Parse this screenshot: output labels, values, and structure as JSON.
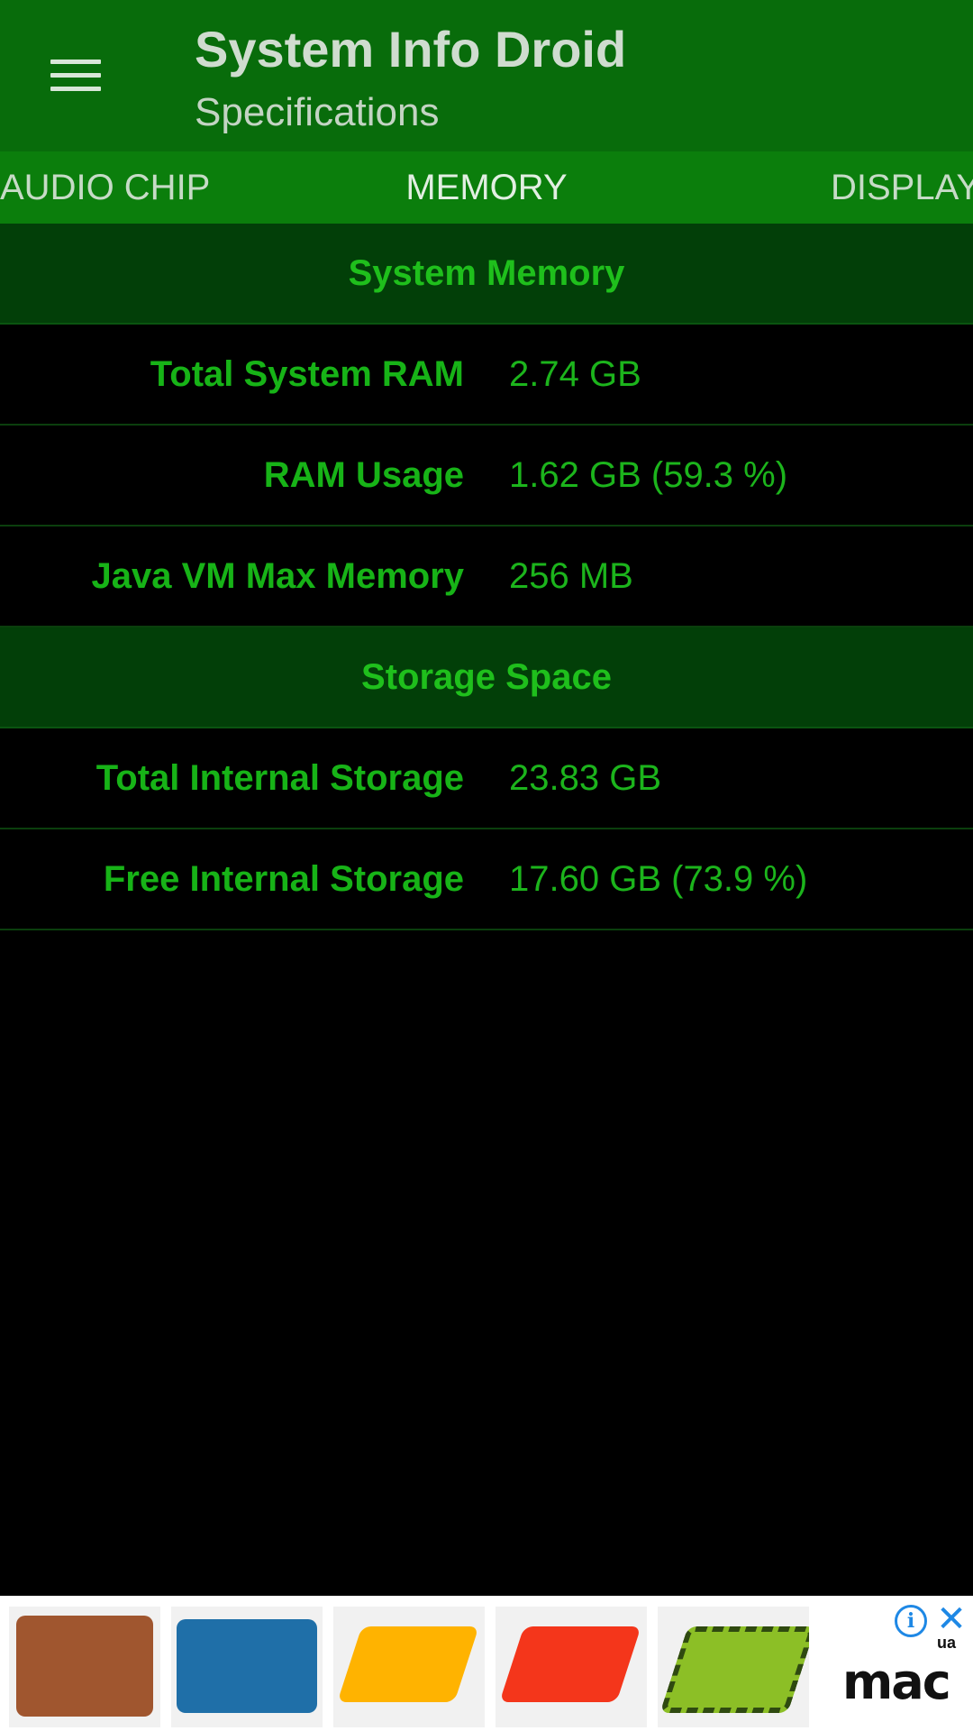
{
  "app_bar": {
    "title": "System Info Droid",
    "subtitle": "Specifications",
    "menu_icon": "hamburger-menu-icon"
  },
  "tabs": [
    {
      "label": "AUDIO CHIP",
      "selected": false
    },
    {
      "label": "MEMORY",
      "selected": true
    },
    {
      "label": "DISPLAY",
      "selected": false
    }
  ],
  "sections": {
    "system_memory": {
      "title": "System Memory",
      "rows": [
        {
          "label": "Total System RAM",
          "value": "2.74 GB"
        },
        {
          "label": "RAM Usage",
          "value": "1.62 GB (59.3 %)"
        },
        {
          "label": "Java VM Max Memory",
          "value": "256 MB"
        }
      ]
    },
    "storage_space": {
      "title": "Storage Space",
      "rows": [
        {
          "label": "Total Internal Storage",
          "value": "23.83 GB"
        },
        {
          "label": "Free Internal Storage",
          "value": "17.60 GB (73.9 %)"
        }
      ]
    }
  },
  "ad": {
    "brand": "mac",
    "brand_suffix": "ua",
    "info_icon": "info-icon",
    "close_icon": "close-icon",
    "products": [
      {
        "name": "brown-leather-sleeve",
        "color": "#a0522d"
      },
      {
        "name": "blue-leather-sleeve",
        "color": "#1f6fa8"
      },
      {
        "name": "yellow-macbook-case",
        "color": "#ffb300"
      },
      {
        "name": "red-macbook-case",
        "color": "#f4361b"
      },
      {
        "name": "camo-macbook-case",
        "color": "#8cbf26"
      }
    ]
  },
  "colors": {
    "app_bar": "#086c0b",
    "tab_bar": "#0b7e0c",
    "section_header_bg": "#023f08",
    "accent_text": "#1cb41c",
    "background": "#000000"
  }
}
